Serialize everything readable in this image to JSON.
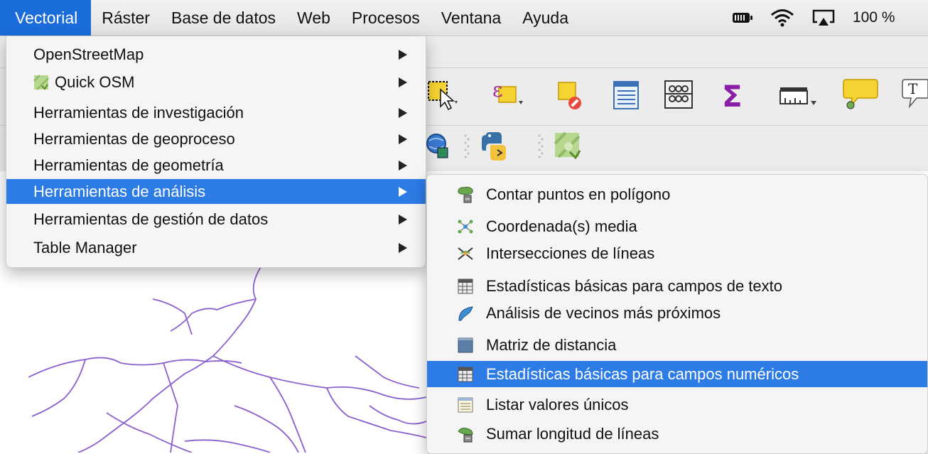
{
  "menubar": {
    "items": [
      "Vectorial",
      "Ráster",
      "Base de datos",
      "Web",
      "Procesos",
      "Ventana",
      "Ayuda"
    ],
    "active_index": 0,
    "battery_percent": "100 %",
    "status_icons": [
      "battery-icon",
      "wifi-icon",
      "airplay-icon"
    ]
  },
  "vectorial_menu": {
    "items": [
      {
        "label": "OpenStreetMap",
        "has_submenu": true
      },
      {
        "label": "Quick OSM",
        "has_submenu": true,
        "icon": "quick-osm-icon"
      },
      {
        "label": "Herramientas de investigación",
        "has_submenu": true
      },
      {
        "label": "Herramientas de geoproceso",
        "has_submenu": true
      },
      {
        "label": "Herramientas de geometría",
        "has_submenu": true
      },
      {
        "label": "Herramientas de análisis",
        "has_submenu": true,
        "highlighted": true
      },
      {
        "label": "Herramientas de gestión de datos",
        "has_submenu": true
      },
      {
        "label": "Table Manager",
        "has_submenu": true
      }
    ]
  },
  "analysis_submenu": {
    "items": [
      {
        "label": "Contar puntos en polígono",
        "icon": "count-points-icon"
      },
      {
        "label": "Coordenada(s) media",
        "icon": "mean-coordinates-icon"
      },
      {
        "label": "Intersecciones de líneas",
        "icon": "line-intersections-icon"
      },
      {
        "label": "Estadísticas básicas para campos de texto",
        "icon": "table-stats-icon"
      },
      {
        "label": "Análisis de vecinos más próximos",
        "icon": "nearest-neighbour-icon"
      },
      {
        "label": "Matriz de distancia",
        "icon": "distance-matrix-icon"
      },
      {
        "label": "Estadísticas básicas para campos numéricos",
        "icon": "table-stats-icon",
        "highlighted": true
      },
      {
        "label": "Listar valores únicos",
        "icon": "unique-values-icon"
      },
      {
        "label": "Sumar longitud de líneas",
        "icon": "sum-lines-icon"
      }
    ]
  },
  "colors": {
    "menu_highlight": "#2d7be5",
    "menubar_active": "#1a6cdb",
    "map_lines": "#8a5fd0"
  }
}
